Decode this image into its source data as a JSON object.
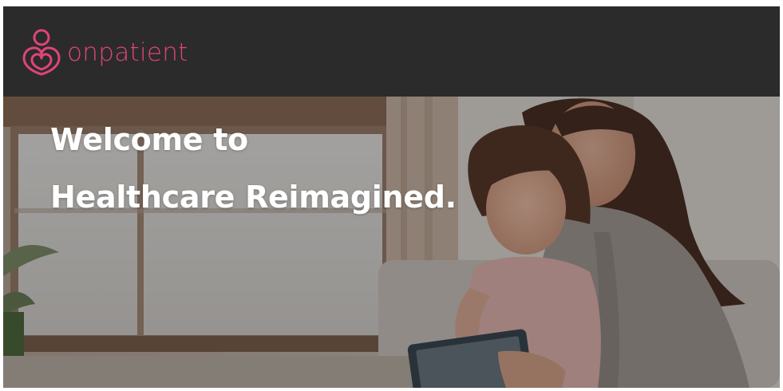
{
  "header": {
    "brand_name": "onpatient",
    "brand_icon": "mother-heart-logo-icon",
    "brand_color": "#e0447a",
    "background_color": "#2b2b2b"
  },
  "hero": {
    "headline_line1": "Welcome to",
    "headline_line2": "Healthcare Reimagined.",
    "image": "mother-and-daughter-with-tablet-photo"
  }
}
